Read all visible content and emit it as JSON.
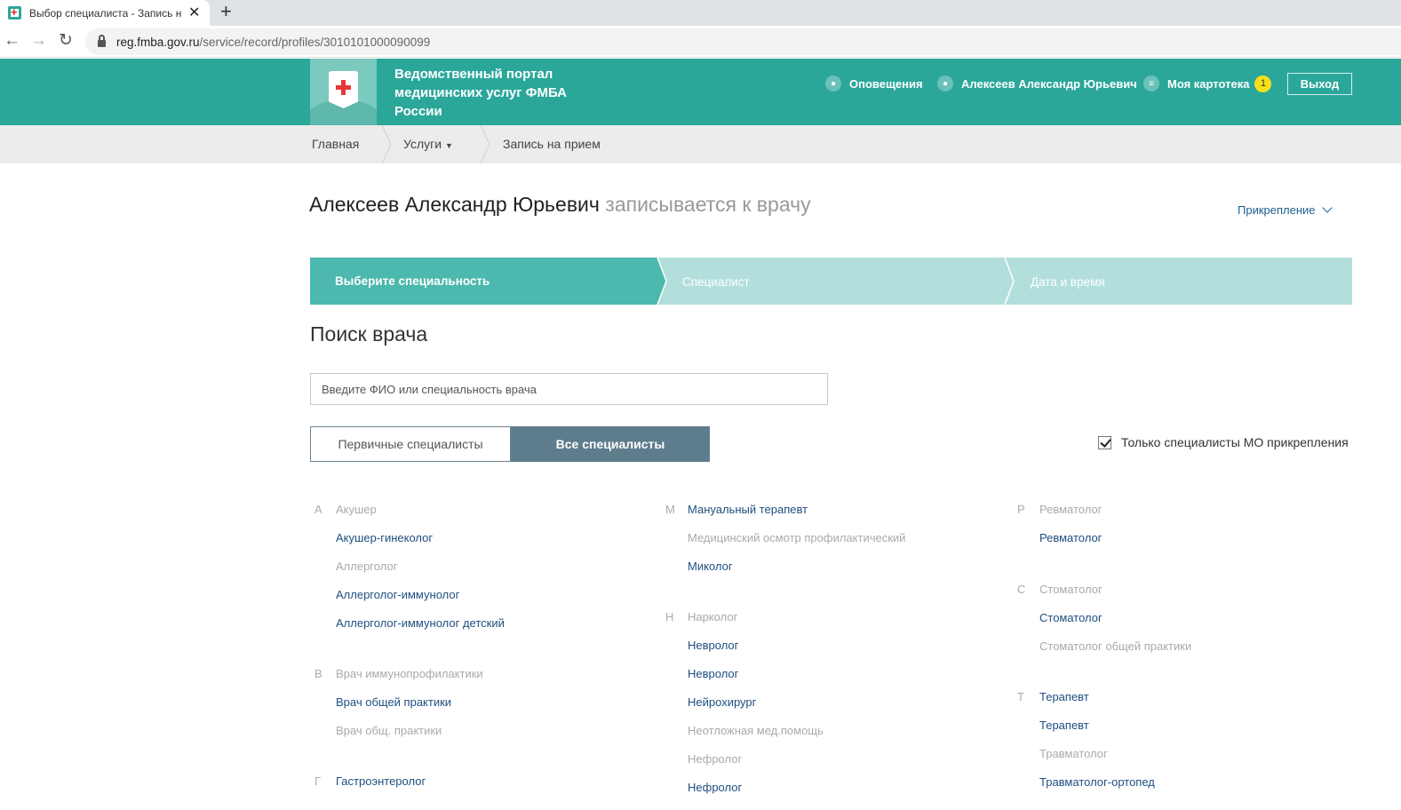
{
  "browser": {
    "tab_title": "Выбор специалиста - Запись на",
    "url_host": "reg.fmba.gov.ru",
    "url_path": "/service/record/profiles/3010101000090099"
  },
  "header": {
    "title": "Ведомственный портал медицинских услуг ФМБА России",
    "notifications": "Оповещения",
    "user": "Алексеев Александр Юрьевич",
    "card": "Моя картотека",
    "card_badge": "1",
    "logout": "Выход"
  },
  "breadcrumb": {
    "home": "Главная",
    "services": "Услуги",
    "current": "Запись на прием"
  },
  "main": {
    "person_name": "Алексеев Александр Юрьевич",
    "person_suffix": "записывается к врачу",
    "attach_link": "Прикрепление",
    "steps": [
      "Выберите специальность",
      "Специалист",
      "Дата и время"
    ],
    "search_title": "Поиск врача",
    "search_placeholder": "Введите ФИО или специальность врача",
    "tab_primary": "Первичные специалисты",
    "tab_all": "Все специалисты",
    "only_attached_label": "Только специалисты МО прикрепления",
    "only_attached_checked": true
  },
  "specialties": {
    "col1": [
      {
        "letter": "А",
        "name": "Акушер",
        "active": false
      },
      {
        "letter": "",
        "name": "Акушер-гинеколог",
        "active": true
      },
      {
        "letter": "",
        "name": "Аллерголог",
        "active": false
      },
      {
        "letter": "",
        "name": "Аллерголог-иммунолог",
        "active": true
      },
      {
        "letter": "",
        "name": "Аллерголог-иммунолог детский",
        "active": true
      },
      {
        "letter": "В",
        "name": "Врач иммунопрофилактики",
        "active": false
      },
      {
        "letter": "",
        "name": "Врач общей практики",
        "active": true
      },
      {
        "letter": "",
        "name": "Врач общ. практики",
        "active": false
      },
      {
        "letter": "Г",
        "name": "Гастроэнтеролог",
        "active": true
      }
    ],
    "col2": [
      {
        "letter": "М",
        "name": "Мануальный терапевт",
        "active": true
      },
      {
        "letter": "",
        "name": "Медицинский осмотр профилактический",
        "active": false
      },
      {
        "letter": "",
        "name": "Миколог",
        "active": true
      },
      {
        "letter": "Н",
        "name": "Нарколог",
        "active": false
      },
      {
        "letter": "",
        "name": "Невролог",
        "active": true
      },
      {
        "letter": "",
        "name": "Невролог",
        "active": true
      },
      {
        "letter": "",
        "name": "Нейрохирург",
        "active": true
      },
      {
        "letter": "",
        "name": "Неотложная мед.помощь",
        "active": false
      },
      {
        "letter": "",
        "name": "Нефролог",
        "active": false
      },
      {
        "letter": "",
        "name": "Нефролог",
        "active": true
      }
    ],
    "col3": [
      {
        "letter": "Р",
        "name": "Ревматолог",
        "active": false
      },
      {
        "letter": "",
        "name": "Ревматолог",
        "active": true
      },
      {
        "letter": "С",
        "name": "Стоматолог",
        "active": false
      },
      {
        "letter": "",
        "name": "Стоматолог",
        "active": true
      },
      {
        "letter": "",
        "name": "Стоматолог общей практики",
        "active": false
      },
      {
        "letter": "Т",
        "name": "Терапевт",
        "active": true
      },
      {
        "letter": "",
        "name": "Терапевт",
        "active": true
      },
      {
        "letter": "",
        "name": "Травматолог",
        "active": false
      },
      {
        "letter": "",
        "name": "Травматолог-ортопед",
        "active": true
      }
    ]
  },
  "colors": {
    "brand": "#2ba79a",
    "step_active": "#4db8ad",
    "step_inactive": "#b2dfdb",
    "link": "#1f4e80",
    "tab_active": "#5e7d8c"
  }
}
